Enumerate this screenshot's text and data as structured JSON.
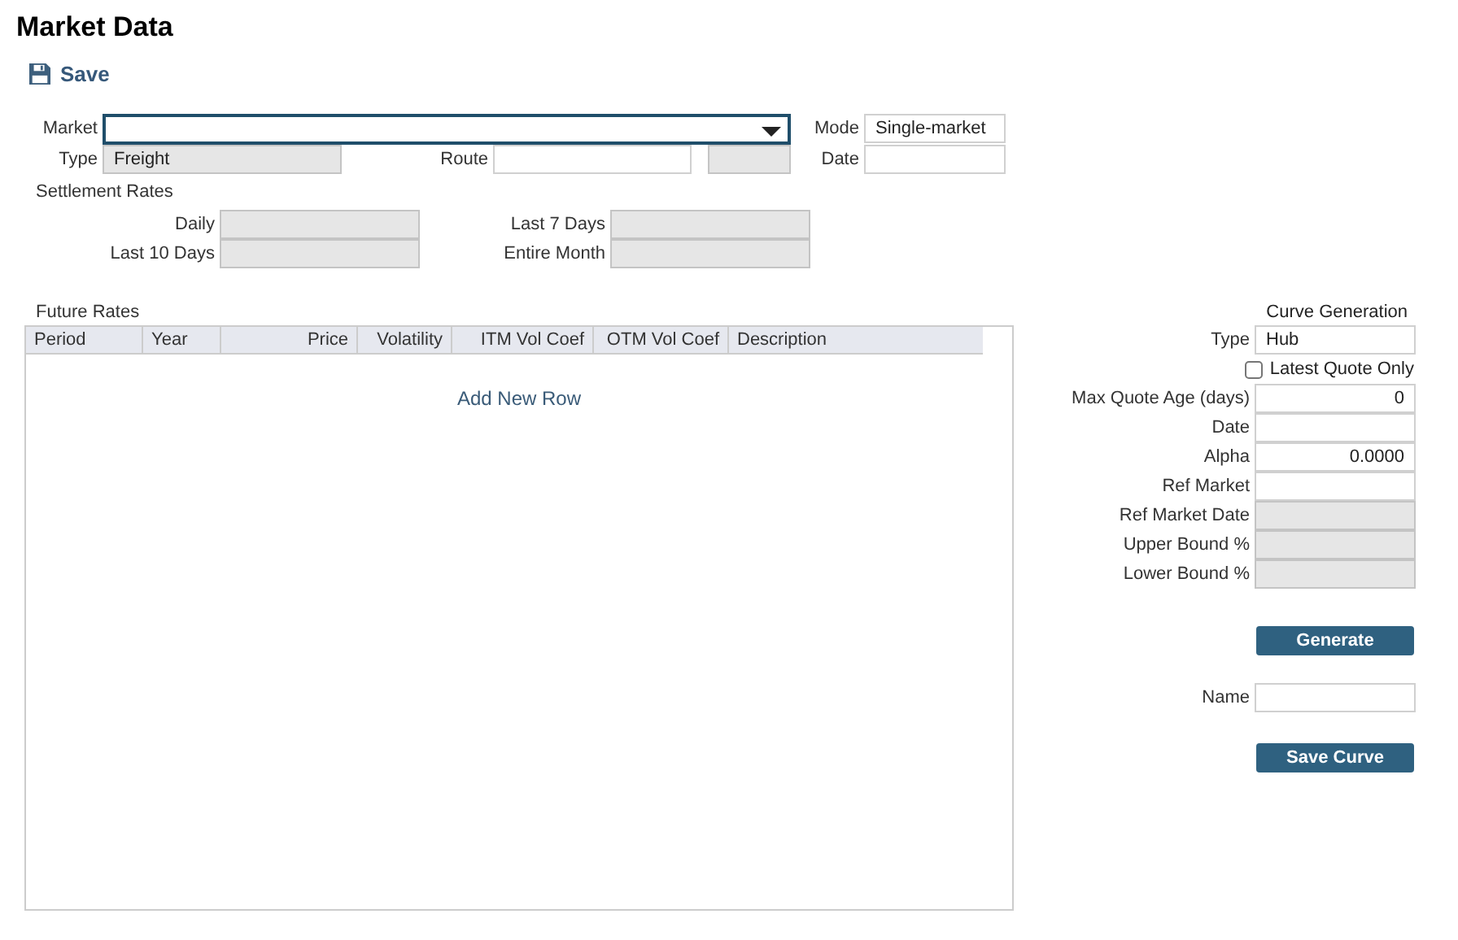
{
  "title": "Market Data",
  "toolbar": [
    {
      "label": "Save"
    }
  ],
  "header_fields": [
    {
      "label": "Market",
      "kind": "dropdown",
      "focused": true
    },
    {
      "label": "Mode",
      "kind": "text",
      "value": "Single-market",
      "disabled": false
    },
    {
      "label": "Type",
      "kind": "text",
      "value": "Freight",
      "disabled": true
    },
    {
      "label": "Route",
      "kind": "text",
      "disabled": false
    },
    {
      "kind": "text",
      "disabled": true
    },
    {
      "label": "Date",
      "kind": "text",
      "disabled": false
    }
  ],
  "settlement_rates": {
    "title": "Settlement Rates",
    "fields": [
      {
        "label": "Daily",
        "disabled": true
      },
      {
        "label": "Last 7 Days",
        "disabled": true
      },
      {
        "label": "Last 10 Days",
        "disabled": true
      },
      {
        "label": "Entire Month",
        "disabled": true
      }
    ]
  },
  "future_rates": {
    "title": "Future Rates",
    "columns": [
      {
        "label": "Period"
      },
      {
        "label": "Year"
      },
      {
        "label": "Price"
      },
      {
        "label": "Volatility"
      },
      {
        "label": "ITM Vol Coef"
      },
      {
        "label": "OTM Vol Coef"
      },
      {
        "label": "Description"
      }
    ],
    "add_row": "Add New Row"
  },
  "curve_generation": {
    "title": "Curve Generation",
    "fields": [
      {
        "label": "Type",
        "kind": "text",
        "value": "Hub",
        "disabled": false
      },
      {
        "label": "Latest Quote Only",
        "kind": "checkbox",
        "checked": false
      },
      {
        "label": "Max Quote Age (days)",
        "kind": "text",
        "value": "0",
        "disabled": false
      },
      {
        "label": "Date",
        "kind": "text",
        "disabled": false
      },
      {
        "label": "Alpha",
        "kind": "text",
        "value": "0.0000",
        "disabled": false
      },
      {
        "label": "Ref Market",
        "kind": "text",
        "disabled": false
      },
      {
        "label": "Ref Market Date",
        "kind": "text",
        "disabled": true
      },
      {
        "label": "Upper Bound %",
        "kind": "text",
        "disabled": true
      },
      {
        "label": "Lower Bound %",
        "kind": "text",
        "disabled": true
      }
    ],
    "generate_button": "Generate",
    "name_field": {
      "label": "Name"
    },
    "save_button": "Save Curve"
  }
}
